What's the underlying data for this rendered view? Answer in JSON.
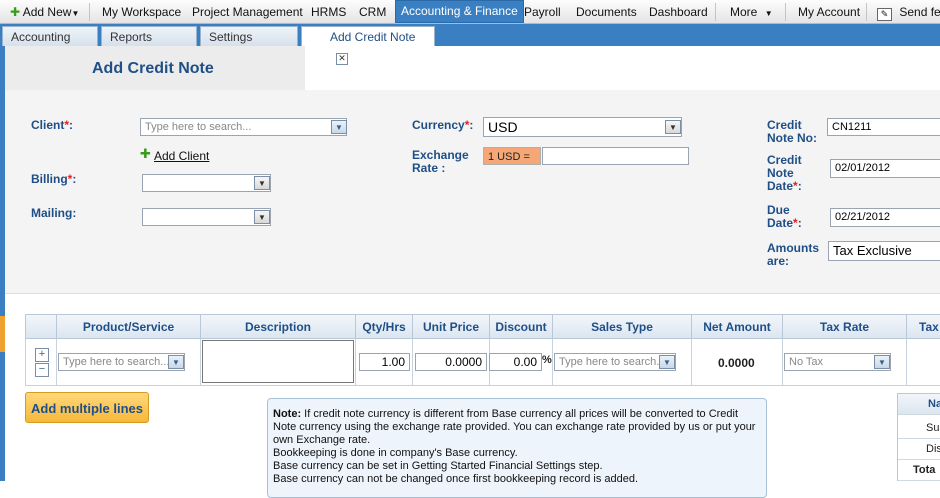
{
  "topnav": {
    "add_new": "Add New",
    "items": [
      "My Workspace",
      "Project Management",
      "HRMS",
      "CRM",
      "Accounting & Finance",
      "Payroll",
      "Documents",
      "Dashboard",
      "More",
      "My Account",
      "Send fe"
    ]
  },
  "subtabs": [
    "Accounting",
    "Reports",
    "Settings",
    "Add Credit Note"
  ],
  "page_title": "Add Credit Note",
  "form": {
    "client_label": "Client",
    "client_placeholder": "Type here to search...",
    "add_client": "Add Client",
    "billing_label": "Billing",
    "mailing_label": "Mailing",
    "currency_label": "Currency",
    "currency_value": "USD",
    "exchange_label_1": "Exchange",
    "exchange_label_2": "Rate :",
    "exchange_prefix": "1 USD =",
    "exchange_value": "",
    "credit_no_label_1": "Credit",
    "credit_no_label_2": "Note No:",
    "credit_no_value": "CN1211",
    "credit_date_label_1": "Credit",
    "credit_date_label_2": "Note",
    "credit_date_label_3": "Date",
    "credit_date_value": "02/01/2012",
    "due_label_1": "Due",
    "due_label_2": "Date",
    "due_value": "02/21/2012",
    "amounts_label_1": "Amounts",
    "amounts_label_2": "are:",
    "amounts_value": "Tax Exclusive"
  },
  "table": {
    "headers": [
      "Product/Service",
      "Description",
      "Qty/Hrs",
      "Unit Price",
      "Discount",
      "Sales Type",
      "Net Amount",
      "Tax Rate",
      "Tax"
    ],
    "row": {
      "product_placeholder": "Type here to search...",
      "qty": "1.00",
      "unit_price": "0.0000",
      "discount": "0.00",
      "discount_unit": "%",
      "sales_type_placeholder": "Type here to search...",
      "net_amount": "0.0000",
      "tax_rate": "No Tax"
    }
  },
  "add_multiple": "Add multiple lines",
  "note": {
    "bold": "Note:",
    "line1": " If credit note currency is different from Base currency all prices will be converted to Credit Note currency using the exchange rate provided. You can exchange rate provided by us or put your own Exchange rate.",
    "line2": "Bookkeeping is done in company's Base currency.",
    "line3": "Base currency can be set in Getting Started Financial Settings step.",
    "line4": "Base currency can not be changed once first bookkeeping record is added."
  },
  "summary": [
    "Na",
    "Sul",
    "Dis",
    "Tota"
  ],
  "colors": {
    "accent": "#3a7fc1",
    "title": "#1f4f86",
    "button": "#f6b83a"
  }
}
